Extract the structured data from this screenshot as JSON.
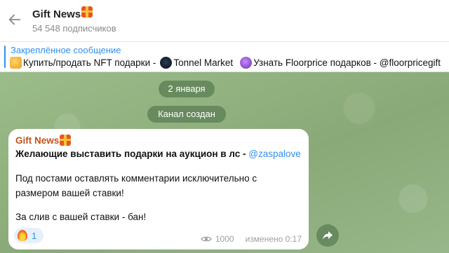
{
  "header": {
    "title": "Gift News",
    "subscribers": "54 548 подписчиков",
    "icons": [
      "back-arrow-icon",
      "gift-icon"
    ]
  },
  "pinned": {
    "label": "Закреплённое сообщение",
    "text_a": "Купить/продать NFT подарки - ",
    "text_b": "Tonnel Market ",
    "text_c": "Узнать Floorprice подарков - @floorpricegift"
  },
  "chat": {
    "date_pill": "2 января",
    "service_pill": "Канал создан"
  },
  "message": {
    "author": "Gift News",
    "line1_text": "Желающие выставить подарки на аукцион в лс - ",
    "line1_mention": "@zaspalove",
    "line2": "Под постами оставлять комментарии исключительно с",
    "line3": "размером вашей ставки!",
    "line4": "За слив с вашей ставки - бан!",
    "reaction_count": "1",
    "views": "1000",
    "edited": "изменено 0:17"
  },
  "colors": {
    "accent": "#3390ec",
    "author": "#c0541d",
    "chat_bg": "#8fb081",
    "pill_bg": "#608458"
  }
}
